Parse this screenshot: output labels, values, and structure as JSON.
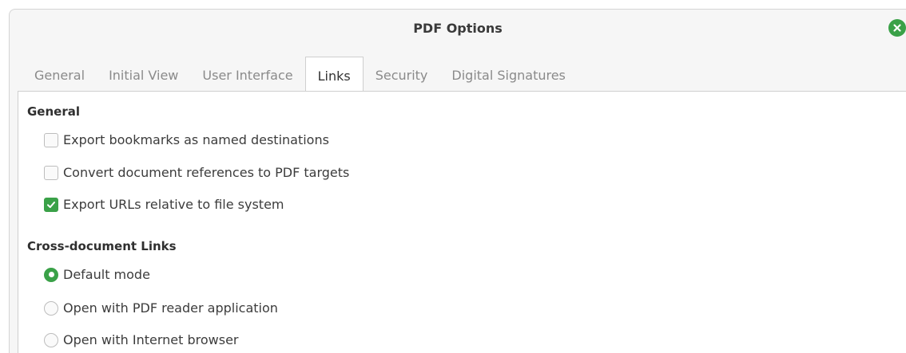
{
  "window": {
    "title": "PDF Options",
    "close_icon": "close-icon",
    "accent_color": "#3aa148"
  },
  "tabs": [
    {
      "label": "General",
      "active": false
    },
    {
      "label": "Initial View",
      "active": false
    },
    {
      "label": "User Interface",
      "active": false
    },
    {
      "label": "Links",
      "active": true
    },
    {
      "label": "Security",
      "active": false
    },
    {
      "label": "Digital Signatures",
      "active": false
    }
  ],
  "general": {
    "heading": "General",
    "options": [
      {
        "label": "Export bookmarks as named destinations",
        "checked": false
      },
      {
        "label": "Convert document references to PDF targets",
        "checked": false
      },
      {
        "label": "Export URLs relative to file system",
        "checked": true
      }
    ]
  },
  "cross_document": {
    "heading": "Cross-document Links",
    "options": [
      {
        "label": "Default mode",
        "selected": true
      },
      {
        "label": "Open with PDF reader application",
        "selected": false
      },
      {
        "label": "Open with Internet browser",
        "selected": false
      }
    ]
  }
}
